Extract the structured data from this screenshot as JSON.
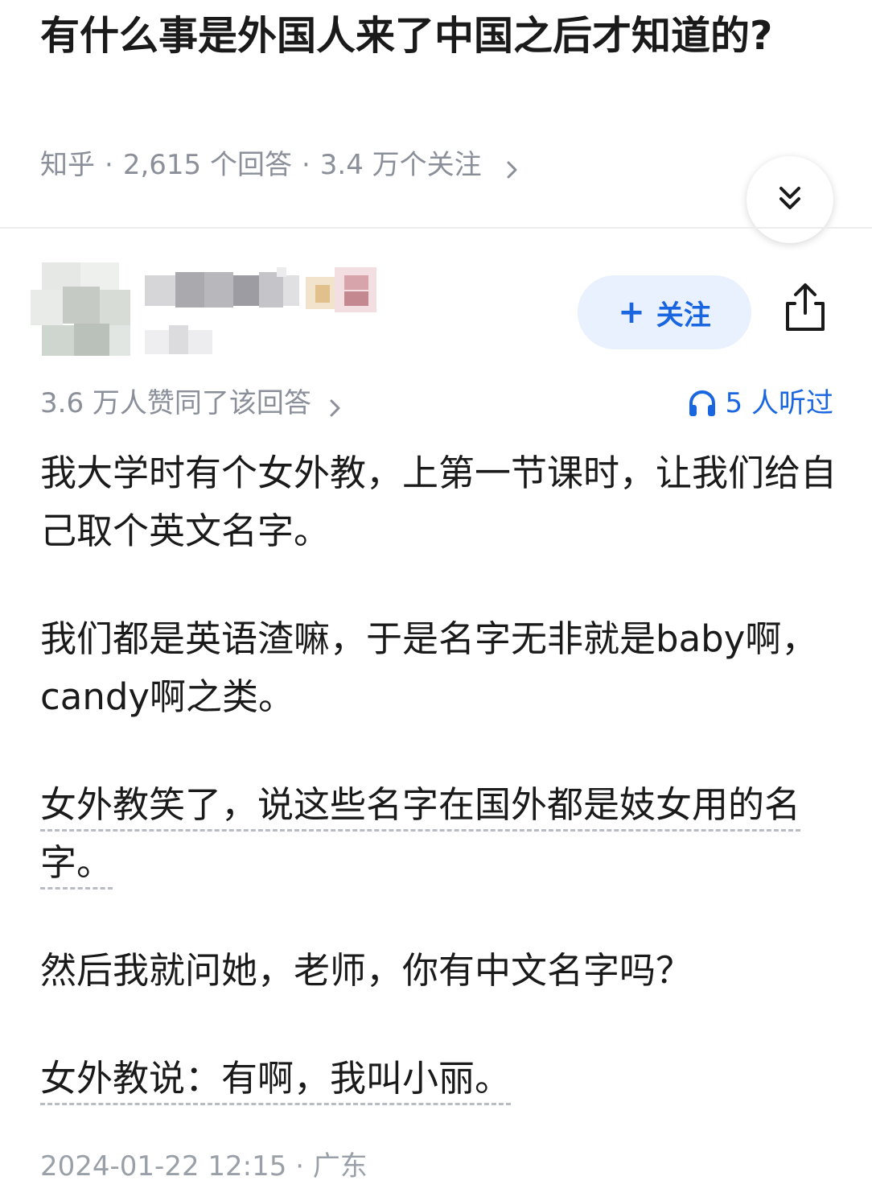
{
  "question": {
    "title": "有什么事是外国人来了中国之后才知道的?",
    "source": "知乎",
    "answers_count": "2,615 个回答",
    "followers_count": "3.4 万个关注"
  },
  "author": {
    "follow_label": "关注",
    "follow_plus": "+"
  },
  "answer": {
    "votes_text": "3.6 万人赞同了该回答",
    "listened_text": "5 人听过",
    "paragraphs": [
      "我大学时有个女外教，上第一节课时，让我们给自己取个英文名字。",
      "我们都是英语渣嘛，于是名字无非就是baby啊，candy啊之类。",
      "女外教笑了，说这些名字在国外都是妓女用的名字。",
      "然后我就问她，老师，你有中文名字吗？",
      "女外教说：有啊，我叫小丽。"
    ],
    "timestamp": "2024-01-22 12:15 · 广东"
  },
  "icons": {
    "collapse": "double-chevron-down-icon",
    "share": "share-icon",
    "listen": "headphone-icon",
    "meta_more": "chevron-right-icon"
  },
  "colors": {
    "accent": "#1966e0",
    "follow_bg": "#e9f1fe",
    "meta_gray": "#8a8f99"
  }
}
